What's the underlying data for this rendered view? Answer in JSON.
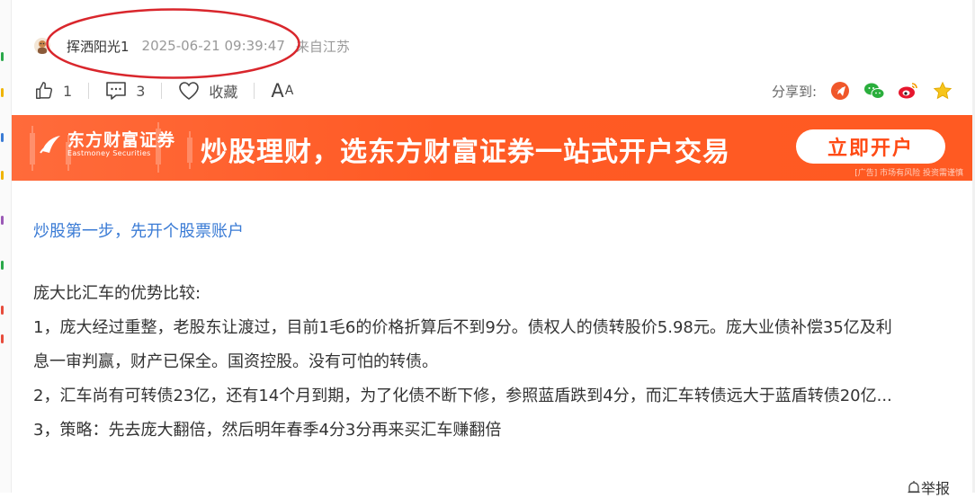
{
  "author": {
    "name": "挥洒阳光1",
    "time": "2025-06-21 09:39:47",
    "location": "来自江苏"
  },
  "actions": {
    "like_count": "1",
    "comment_count": "3",
    "favorite_label": "收藏",
    "font_size_label": "A",
    "font_size_small": "A"
  },
  "share": {
    "label": "分享到:",
    "targets": [
      "telegram-icon",
      "wechat-icon",
      "weibo-icon",
      "favorite-star-icon"
    ]
  },
  "banner": {
    "brand_cn": "东方财富证券",
    "brand_en": "Eastmoney Securities",
    "slogan": "炒股理财，选东方财富证券一站式开户交易",
    "button_label": "立即开户",
    "ad_note": "[广告] 市场有风险 投资需谨慎",
    "colors": {
      "background": "#ff5a24",
      "button_text": "#ff4a14"
    }
  },
  "promo_link": "炒股第一步，先开个股票账户",
  "article": {
    "lines": [
      "庞大比汇车的优势比较:",
      "1，庞大经过重整，老股东让渡过，目前1毛6的价格折算后不到9分。债权人的债转股价5.98元。庞大业债补偿35亿及利",
      "息一审判赢，财产已保全。国资控股。没有可怕的转债。",
      "2，汇车尚有可转债23亿，还有14个月到期，为了化债不断下修，参照蓝盾跌到4分，而汇车转债远大于蓝盾转债20亿...",
      "3，策略：先去庞大翻倍，然后明年春季4分3分再来买汇车赚翻倍"
    ]
  },
  "report_label": "举报",
  "highlight_color": "#d9262c",
  "link_color": "#3a7bd5"
}
